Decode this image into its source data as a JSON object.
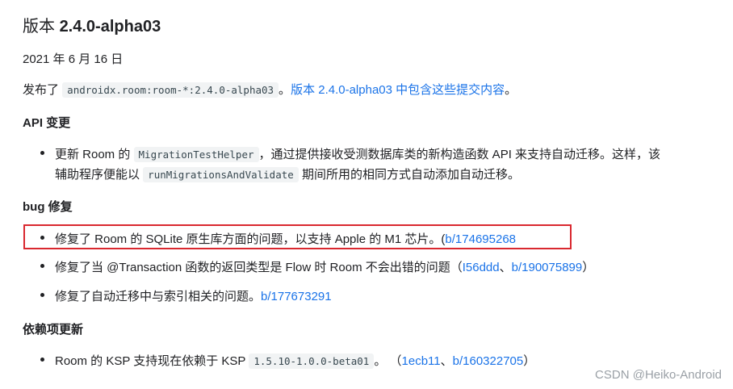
{
  "heading": {
    "prefix": "版本 ",
    "version": "2.4.0-alpha03"
  },
  "date": "2021 年 6 月 16 日",
  "release": {
    "prefix": "发布了 ",
    "artifact": "androidx.room:room-*:2.4.0-alpha03",
    "separator": "。",
    "link": "版本 2.4.0-alpha03 中包含这些提交内容",
    "suffix": "。"
  },
  "api_section": {
    "title": "API 变更",
    "item": {
      "text1": "更新 Room 的 ",
      "code1": "MigrationTestHelper",
      "text2": "，通过提供接收受测数据库类的新构造函数 API 来支持自动迁移。这样，该",
      "text3": "辅助程序便能以 ",
      "code2": "runMigrationsAndValidate",
      "text4": " 期间所用的相同方式自动添加自动迁移。"
    }
  },
  "bug_section": {
    "title": "bug 修复",
    "item1": {
      "text": "修复了 Room 的 SQLite 原生库方面的问题，以支持 Apple 的 M1 芯片。(",
      "link": "b/174695268"
    },
    "item2": {
      "text": "修复了当 @Transaction 函数的返回类型是 Flow 时 Room 不会出错的问题（",
      "link1": "I56ddd",
      "sep": "、",
      "link2": "b/190075899",
      "suffix": "）"
    },
    "item3": {
      "text": "修复了自动迁移中与索引相关的问题。",
      "link": "b/177673291"
    }
  },
  "deps_section": {
    "title": "依赖项更新",
    "item": {
      "text": "Room 的 KSP 支持现在依赖于 KSP ",
      "code": "1.5.10-1.0.0-beta01",
      "mid": "。 （",
      "link1": "1ecb11",
      "sep": "、",
      "link2": "b/160322705",
      "suffix": "）"
    }
  },
  "watermark": "CSDN @Heiko-Android",
  "colors": {
    "link": "#1a73e8",
    "highlight_border": "#d9282f",
    "code_bg": "#f1f3f4"
  }
}
